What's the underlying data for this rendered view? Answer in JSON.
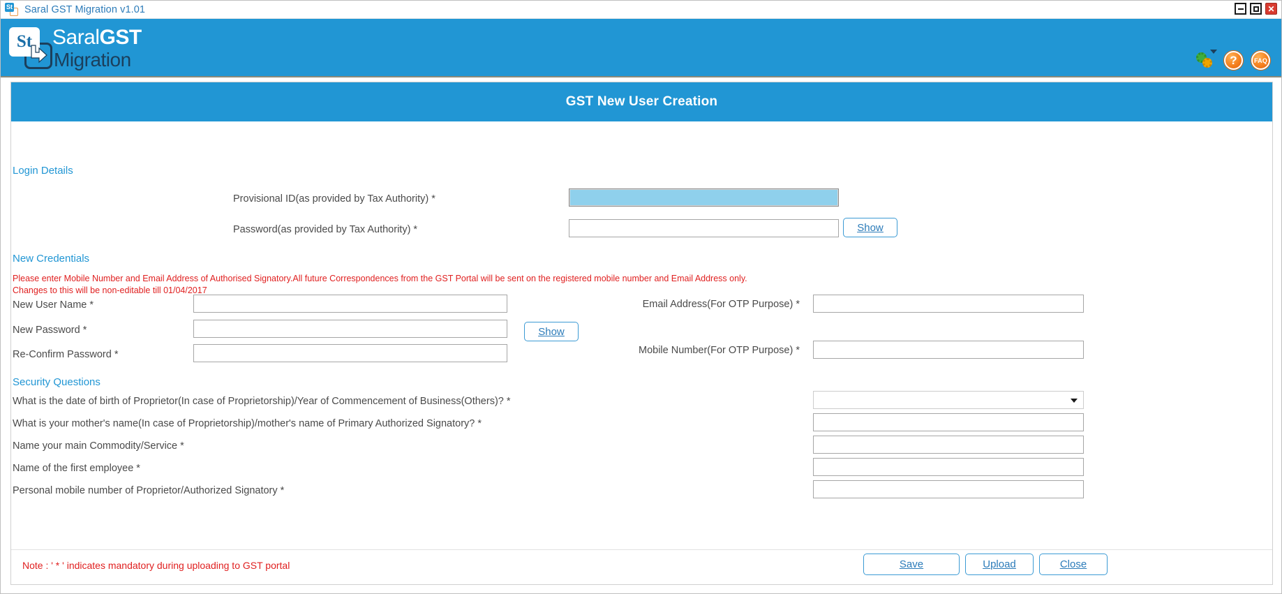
{
  "window": {
    "title": "Saral GST Migration v1.01",
    "icon": "app-icon",
    "controls": {
      "minimize": "–",
      "maximize": "□",
      "close": "✕"
    }
  },
  "brand": {
    "badge": "St",
    "name_light": "Saral",
    "name_bold": "GST",
    "subtitle": "Migration",
    "icons": [
      {
        "name": "settings-gear-icon",
        "label": ""
      },
      {
        "name": "help-icon",
        "label": "?"
      },
      {
        "name": "faq-icon",
        "label": "FAQ"
      }
    ]
  },
  "panel": {
    "title": "GST New User Creation"
  },
  "login_details": {
    "heading": "Login Details",
    "fields": [
      {
        "label": "Provisional ID(as provided by Tax Authority) *",
        "value": "",
        "placeholder": "",
        "focused": true
      },
      {
        "label": "Password(as provided by Tax Authority) *",
        "value": "",
        "placeholder": "",
        "focused": false
      }
    ],
    "show_button": {
      "prefix": "S",
      "mnemonic": "h",
      "suffix": "ow"
    }
  },
  "new_credentials": {
    "heading": "New Credentials",
    "note_line1": "Please enter Mobile Number and Email Address of Authorised Signatory.All future Correspondences  from the GST Portal  will be sent on the registered mobile number and Email Address only.",
    "note_line2": " Changes to this will be non-editable till 01/04/2017",
    "left_fields": [
      {
        "label": "New User Name *",
        "value": "",
        "placeholder": ""
      },
      {
        "label": "New Password *",
        "value": "",
        "placeholder": ""
      },
      {
        "label": "Re-Confirm Password *",
        "value": "",
        "placeholder": ""
      }
    ],
    "right_fields": [
      {
        "label": "Email Address(For OTP Purpose) *",
        "value": "",
        "placeholder": ""
      },
      {
        "label": "Mobile Number(For OTP Purpose) *",
        "value": "",
        "placeholder": ""
      }
    ],
    "show_button": {
      "prefix": "S",
      "mnemonic": "h",
      "suffix": "ow"
    }
  },
  "security_questions": {
    "heading": "Security Questions",
    "items": [
      {
        "label": "What is the date of birth of Proprietor(In case of Proprietorship)/Year of Commencement of Business(Others)? *",
        "type": "select",
        "value": "",
        "options": [
          ""
        ]
      },
      {
        "label": "What is your mother's name(In case of Proprietorship)/mother's name of Primary Authorized Signatory? *",
        "type": "text",
        "value": "",
        "placeholder": ""
      },
      {
        "label": "Name your main Commodity/Service *",
        "type": "text",
        "value": "",
        "placeholder": ""
      },
      {
        "label": "Name of the first employee *",
        "type": "text",
        "value": "",
        "placeholder": ""
      },
      {
        "label": "Personal mobile number of Proprietor/Authorized Signatory *",
        "type": "text",
        "value": "",
        "placeholder": ""
      }
    ]
  },
  "footer": {
    "note": "Note : ' * ' indicates mandatory during uploading to GST portal",
    "buttons": [
      {
        "name": "save",
        "prefix": "",
        "mnemonic": "S",
        "suffix": "ave"
      },
      {
        "name": "upload",
        "prefix": "",
        "mnemonic": "U",
        "suffix": "pload"
      },
      {
        "name": "close",
        "prefix": "",
        "mnemonic": "C",
        "suffix": "lose"
      }
    ]
  },
  "colors": {
    "brand_blue": "#2196d4",
    "accent_blue": "#2b7bb9",
    "focus_fill": "#8fd0ec",
    "alert_red": "#e02020",
    "label_gray": "#4a4a4a"
  }
}
